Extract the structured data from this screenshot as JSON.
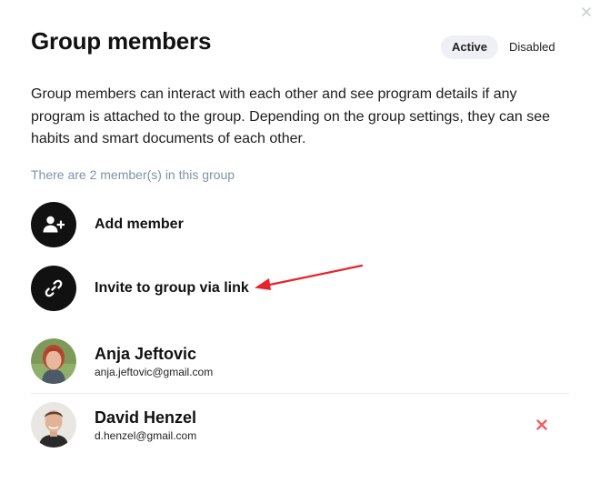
{
  "modal": {
    "title": "Group members",
    "close_icon": "close-icon"
  },
  "status_filter": {
    "options": [
      "Active",
      "Disabled"
    ],
    "selected": "Active"
  },
  "description": "Group members can interact with each other and see program details if any program is attached to the group. Depending on the group settings, they can see habits and smart documents of each other.",
  "member_count_text": "There are 2 member(s) in this group",
  "actions": {
    "add_member": {
      "label": "Add member",
      "icon": "user-plus-icon"
    },
    "invite_link": {
      "label": "Invite to group via link",
      "icon": "link-icon"
    }
  },
  "annotation": {
    "color": "#e8222a"
  },
  "members": [
    {
      "name": "Anja Jeftovic",
      "email": "anja.jeftovic@gmail.com"
    },
    {
      "name": "David Henzel",
      "email": "d.henzel@gmail.com",
      "remove_icon": "remove-icon"
    }
  ],
  "colors": {
    "muted_text": "#7f94a8",
    "remove": "#ef5f5f",
    "icon_circle": "#111111"
  }
}
